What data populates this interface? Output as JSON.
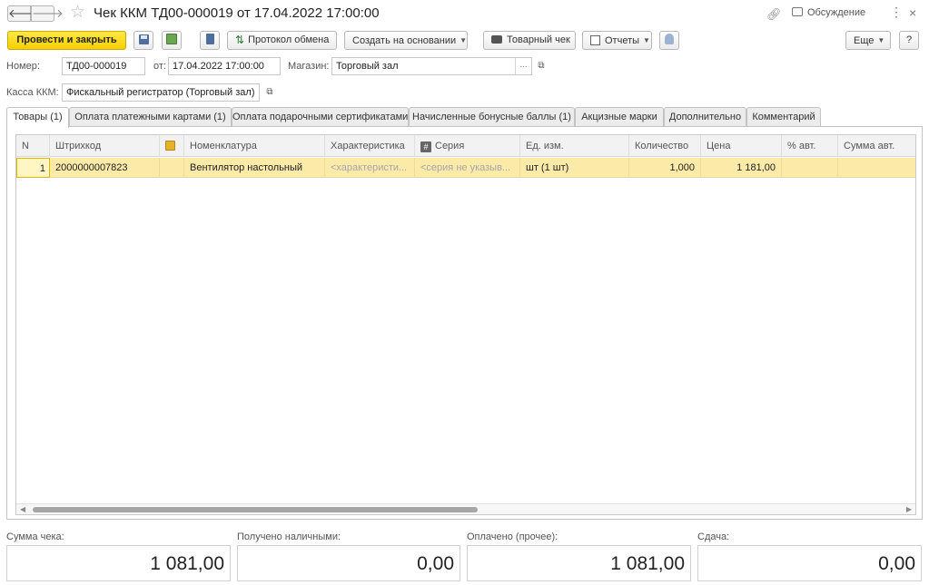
{
  "window": {
    "title": "Чек ККМ ТД00-000019 от 17.04.2022 17:00:00",
    "back_glyph": "🡐",
    "forward_glyph": "🡒",
    "discussion_label": "Обсуждение",
    "menu_glyph": "⋮",
    "close_glyph": "×"
  },
  "toolbar": {
    "post_and_close": "Провести и закрыть",
    "exchange_protocol": "Протокол обмена",
    "create_based_on": "Создать на основании",
    "sales_receipt": "Товарный чек",
    "reports": "Отчеты",
    "more": "Еще",
    "help": "?"
  },
  "header": {
    "number_label": "Номер:",
    "number_value": "ТД00-000019",
    "date_label": "от:",
    "date_value": "17.04.2022 17:00:00",
    "store_label": "Магазин:",
    "store_value": "Торговый зал",
    "register_label": "Касса ККМ:",
    "register_value": "Фискальный регистратор (Торговый зал)",
    "ellipsis": "...",
    "open_glyph": "⧉"
  },
  "tabs": [
    {
      "label": "Товары (1)",
      "active": true
    },
    {
      "label": "Оплата платежными картами (1)"
    },
    {
      "label": "Оплата подарочными сертификатами"
    },
    {
      "label": "Начисленные бонусные баллы (1)"
    },
    {
      "label": "Акцизные марки"
    },
    {
      "label": "Дополнительно"
    },
    {
      "label": "Комментарий"
    }
  ],
  "table": {
    "columns": [
      "N",
      "Штрихкод",
      "",
      "Номенклатура",
      "Характеристика",
      "Серия",
      "Ед. изм.",
      "Количество",
      "Цена",
      "% авт.",
      "Сумма авт."
    ],
    "rows": [
      {
        "n": "1",
        "barcode": "2000000007823",
        "flag": "",
        "item": "Вентилятор настольный",
        "characteristic": "<характеристи...",
        "series": "<серия не указыв...",
        "unit": "шт (1 шт)",
        "quantity": "1,000",
        "price": "1 181,00",
        "auto_pct": "",
        "auto_sum": ""
      }
    ],
    "scrollbar": {
      "position_fraction": 0.0,
      "visible_fraction": 0.5
    }
  },
  "totals": {
    "receipt_sum_label": "Сумма чека:",
    "receipt_sum_value": "1 081,00",
    "cash_received_label": "Получено наличными:",
    "cash_received_value": "0,00",
    "paid_other_label": "Оплачено (прочее):",
    "paid_other_value": "1 081,00",
    "change_label": "Сдача:",
    "change_value": "0,00"
  },
  "colors": {
    "primary_button": "#f5cf00",
    "selected_row": "#fbeaa8"
  }
}
